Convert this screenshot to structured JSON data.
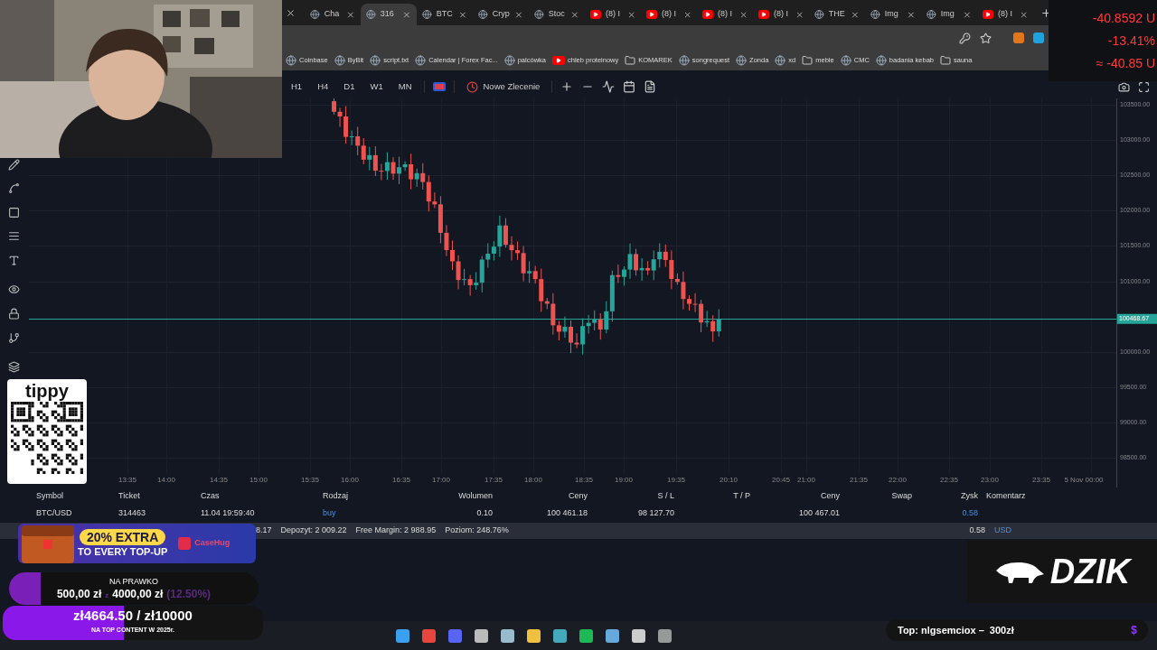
{
  "browser": {
    "tabs": [
      {
        "label": "Cha",
        "kind": "site",
        "selected": false
      },
      {
        "label": "316",
        "kind": "site",
        "selected": true
      },
      {
        "label": "BTC",
        "kind": "site",
        "selected": false
      },
      {
        "label": "Cryp",
        "kind": "site",
        "selected": false
      },
      {
        "label": "Stoc",
        "kind": "site",
        "selected": false
      },
      {
        "label": "(8) I",
        "kind": "video",
        "selected": false
      },
      {
        "label": "(8) I",
        "kind": "video",
        "selected": false
      },
      {
        "label": "(8) I",
        "kind": "video",
        "selected": false
      },
      {
        "label": "(8) I",
        "kind": "video",
        "selected": false
      },
      {
        "label": "THE",
        "kind": "site",
        "selected": false
      },
      {
        "label": "Img",
        "kind": "site",
        "selected": false
      },
      {
        "label": "Img",
        "kind": "site",
        "selected": false
      },
      {
        "label": "(8) I",
        "kind": "video",
        "selected": false
      }
    ],
    "bookmarks": [
      {
        "label": "Coinbase",
        "kind": "site"
      },
      {
        "label": "ByBit",
        "kind": "site"
      },
      {
        "label": "script.txt",
        "kind": "site"
      },
      {
        "label": "Calendar | Forex Fac...",
        "kind": "site"
      },
      {
        "label": "palcówka",
        "kind": "site"
      },
      {
        "label": "chleb proteinowy",
        "kind": "video"
      },
      {
        "label": "KOMAREK",
        "kind": "folder"
      },
      {
        "label": "songrequest",
        "kind": "site"
      },
      {
        "label": "Zonda",
        "kind": "site"
      },
      {
        "label": "xd",
        "kind": "site"
      },
      {
        "label": "meble",
        "kind": "folder"
      },
      {
        "label": "CMC",
        "kind": "site"
      },
      {
        "label": "badania kebab",
        "kind": "site"
      },
      {
        "label": "sauna",
        "kind": "folder"
      }
    ]
  },
  "ticker": [
    "-40.8592 U",
    "-13.41%",
    "≈ -40.85 U"
  ],
  "toolbar": {
    "timeframes": [
      "H1",
      "H4",
      "D1",
      "W1",
      "MN"
    ],
    "order_button": "Nowe Zlecenie"
  },
  "chart": {
    "price_labels": [
      "103500.00",
      "103000.00",
      "102500.00",
      "102000.00",
      "101500.00",
      "101000.00",
      "100000.00",
      "99500.00",
      "99000.00",
      "98500.00"
    ],
    "current_price": "100468.67",
    "time_labels": [
      "13:35",
      "14:00",
      "14:35",
      "15:00",
      "15:35",
      "16:00",
      "16:35",
      "17:00",
      "17:35",
      "18:00",
      "18:35",
      "19:00",
      "19:35",
      "20:10",
      "20:45",
      "21:00",
      "21:35",
      "22:00",
      "22:35",
      "23:00",
      "23:35",
      "5 Nov 00:00"
    ]
  },
  "table": {
    "columns": [
      "Symbol",
      "Ticket",
      "Czas",
      "Rodzaj",
      "Wolumen",
      "Ceny",
      "S / L",
      "T / P",
      "Ceny",
      "Swap",
      "Zysk",
      "Komentarz"
    ],
    "rows": [
      [
        "BTC/USD",
        "314463",
        "11.04 19:59:40",
        "buy",
        "0.10",
        "100 461.18",
        "98 127.70",
        "",
        "100 467.01",
        "",
        "0.58",
        ""
      ]
    ]
  },
  "summary": {
    "items": [
      "8.17",
      "Depozyt: 2 009.22",
      "Free Margin: 2 988.95",
      "Poziom: 248.76%"
    ],
    "profit": "0.58",
    "currency": "USD"
  },
  "overlays": {
    "tipply": "tippy",
    "promo": {
      "headline": "20% EXTRA",
      "subline": "TO EVERY TOP-UP",
      "brand": "CaseHug"
    },
    "goals": [
      {
        "kind": "compact",
        "title": "NA PRAWKO",
        "current": "500,00 zł",
        "separator": "z",
        "target": "4000,00 zł",
        "percent": "(12.50%)",
        "level": 0.125
      },
      {
        "kind": "large",
        "title": "zł4664.50 / zł10000",
        "subtitle": "NA TOP CONTENT W 2025r.",
        "level": 0.466
      }
    ],
    "sponsor": "DZIK",
    "top_donor": {
      "text": "Top: nlgsemciox –  300zł",
      "symbol": "$"
    }
  }
}
